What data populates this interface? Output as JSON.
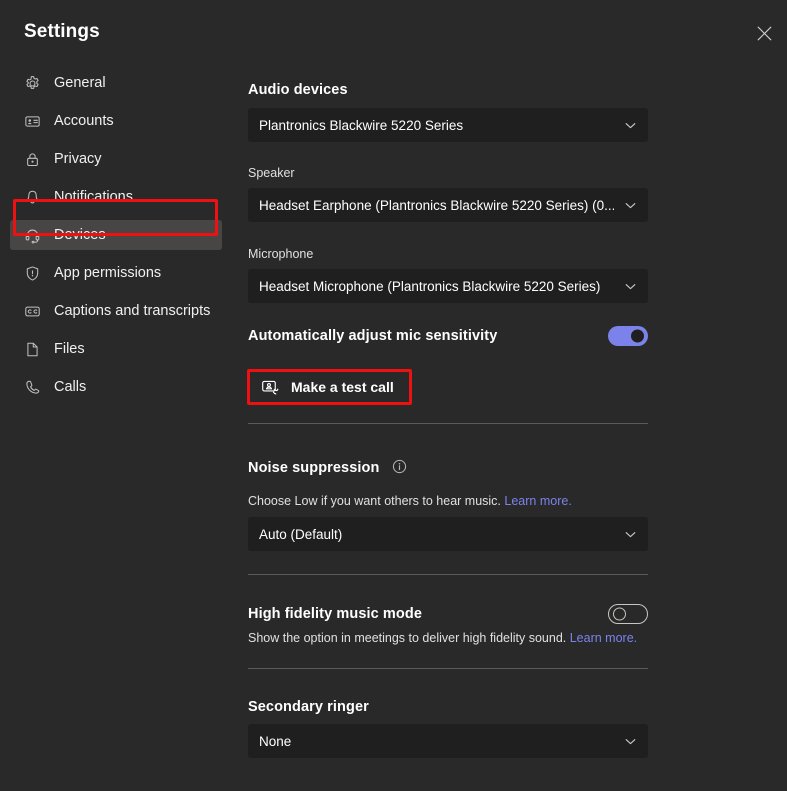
{
  "window": {
    "title": "Settings",
    "close_icon": "close-icon"
  },
  "sidebar": {
    "items": [
      {
        "id": "general",
        "label": "General",
        "icon": "gear-icon",
        "selected": false
      },
      {
        "id": "accounts",
        "label": "Accounts",
        "icon": "id-card-icon",
        "selected": false
      },
      {
        "id": "privacy",
        "label": "Privacy",
        "icon": "lock-icon",
        "selected": false
      },
      {
        "id": "notifications",
        "label": "Notifications",
        "icon": "bell-icon",
        "selected": false
      },
      {
        "id": "devices",
        "label": "Devices",
        "icon": "headset-icon",
        "selected": true
      },
      {
        "id": "app-permissions",
        "label": "App permissions",
        "icon": "shield-icon",
        "selected": false
      },
      {
        "id": "captions",
        "label": "Captions and transcripts",
        "icon": "closed-caption-icon",
        "selected": false
      },
      {
        "id": "files",
        "label": "Files",
        "icon": "file-icon",
        "selected": false
      },
      {
        "id": "calls",
        "label": "Calls",
        "icon": "phone-icon",
        "selected": false
      }
    ]
  },
  "main": {
    "audio_devices": {
      "heading": "Audio devices",
      "selected": "Plantronics Blackwire 5220 Series"
    },
    "speaker": {
      "label": "Speaker",
      "selected": "Headset Earphone (Plantronics Blackwire 5220 Series) (0..."
    },
    "microphone": {
      "label": "Microphone",
      "selected": "Headset Microphone (Plantronics Blackwire 5220 Series)"
    },
    "auto_mic": {
      "label": "Automatically adjust mic sensitivity",
      "state": "on"
    },
    "test_call": {
      "label": "Make a test call",
      "icon": "test-call-icon"
    },
    "noise_suppression": {
      "heading": "Noise suppression",
      "info_icon": "info-icon",
      "description": "Choose Low if you want others to hear music.",
      "link_text": "Learn more.",
      "selected": "Auto (Default)"
    },
    "high_fidelity": {
      "heading": "High fidelity music mode",
      "state": "off",
      "description": "Show the option in meetings to deliver high fidelity sound.",
      "link_text": "Learn more."
    },
    "secondary_ringer": {
      "heading": "Secondary ringer",
      "selected": "None"
    }
  },
  "annotations": {
    "highlight_color": "#ee1111",
    "devices_highlight": "Devices",
    "test_call_highlight": "Make a test call"
  },
  "theme": {
    "background": "#292929",
    "field_background": "#1f1f1f",
    "selected_item": "#484644",
    "accent": "#7b83eb",
    "divider": "#5a5a5a"
  }
}
